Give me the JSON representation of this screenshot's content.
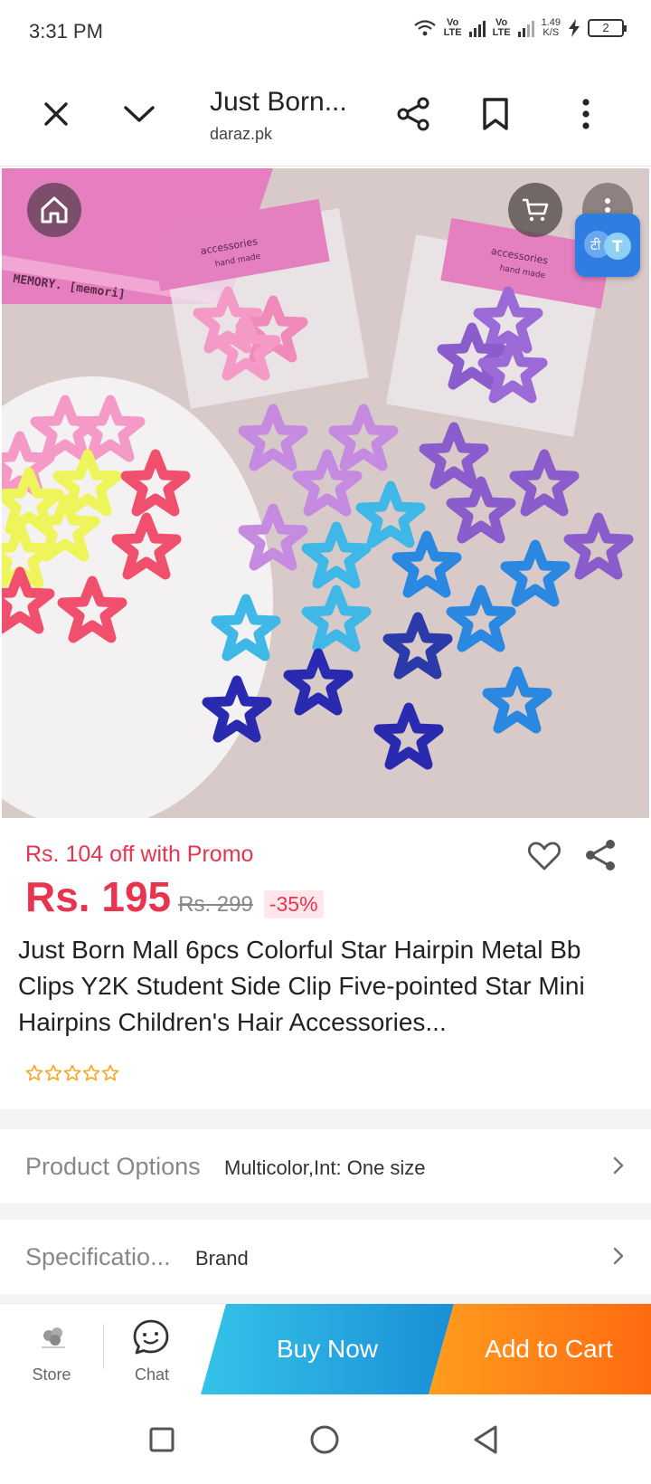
{
  "status_bar": {
    "time": "3:31 PM",
    "volte1": "Vo\nLTE",
    "volte2": "Vo\nLTE",
    "speed": "1.49\nK/S",
    "battery": "2"
  },
  "browser": {
    "title": "Just Born...",
    "url": "daraz.pk",
    "icons": [
      "close-icon",
      "chevron-down-icon",
      "share-icon",
      "bookmark-icon",
      "more-vertical-icon"
    ]
  },
  "product_image": {
    "bag_label_1": "accessories",
    "bag_sub_1": "hand made",
    "bag_label_2": "accessories",
    "bag_sub_2": "hand made",
    "book_text": "MEMORY. [memori]",
    "translate_glyphs": "टी T"
  },
  "price": {
    "promo": "Rs. 104 off with Promo",
    "current": "Rs. 195",
    "original": "Rs. 299",
    "discount": "-35%"
  },
  "product": {
    "title": "Just Born Mall 6pcs Colorful Star Hairpin Metal Bb Clips Y2K Student Side Clip Five-pointed Star Mini Hairpins Children's Hair Accessories...",
    "rating_stars": 0,
    "star_color": "#f5a623"
  },
  "options": {
    "label": "Product Options",
    "value": "Multicolor,Int: One size"
  },
  "specs": {
    "label": "Specificatio...",
    "value": "Brand"
  },
  "actions": {
    "store_label": "Store",
    "chat_label": "Chat",
    "buy_now": "Buy Now",
    "add_to_cart": "Add to Cart"
  },
  "colors": {
    "accent_red": "#e8344f",
    "buy_blue": "#1a8fd6",
    "cart_orange": "#ff6a10"
  }
}
